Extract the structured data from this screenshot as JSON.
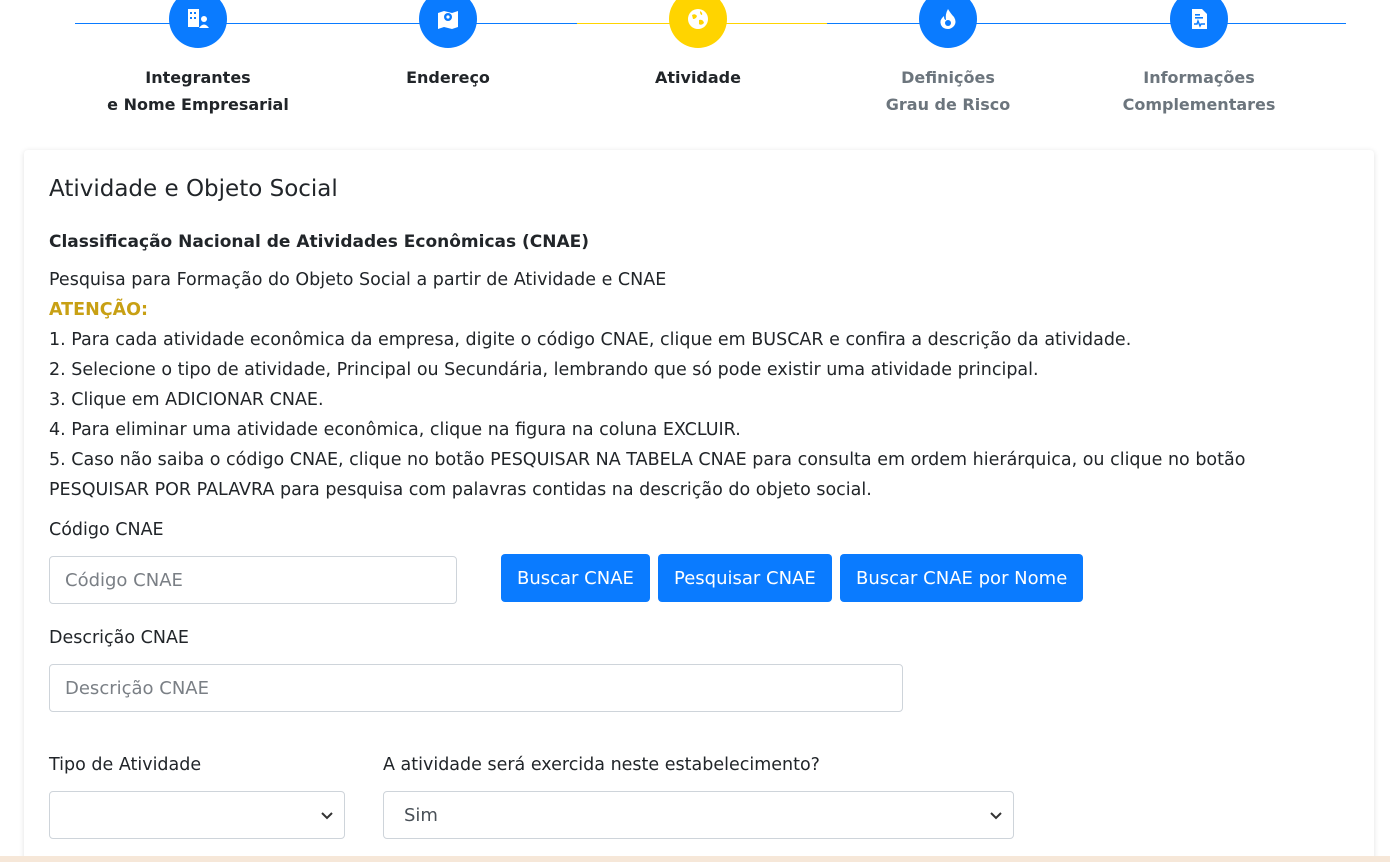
{
  "stepper": {
    "colors": {
      "active": "#0a7bff",
      "current": "#ffd400",
      "done_text": "#212529",
      "pending_text": "#6c757d"
    },
    "steps": [
      {
        "line1": "Integrantes",
        "line2": "e Nome Empresarial",
        "icon": "building-user-icon",
        "state": "done"
      },
      {
        "line1": "Endereço",
        "line2": "",
        "icon": "map-pin-icon",
        "state": "done"
      },
      {
        "line1": "Atividade",
        "line2": "",
        "icon": "globe-icon",
        "state": "current"
      },
      {
        "line1": "Definições",
        "line2": "Grau de Risco",
        "icon": "fire-icon",
        "state": "pending"
      },
      {
        "line1": "Informações",
        "line2": "Complementares",
        "icon": "document-icon",
        "state": "pending"
      }
    ]
  },
  "card": {
    "title": "Atividade e Objeto Social",
    "subtitle": "Classificação Nacional de Atividades Econômicas (CNAE)",
    "intro": "Pesquisa para Formação do Objeto Social a partir de Atividade e CNAE",
    "warning": "ATENÇÃO:",
    "steps": [
      "1. Para cada atividade econômica da empresa, digite o código CNAE, clique em BUSCAR e confira a descrição da atividade.",
      "2. Selecione o tipo de atividade, Principal ou Secundária, lembrando que só pode existir uma atividade principal.",
      "3. Clique em ADICIONAR CNAE.",
      "4. Para eliminar uma atividade econômica, clique na figura na coluna EXCLUIR.",
      "5. Caso não saiba o código CNAE, clique no botão PESQUISAR NA TABELA CNAE para consulta em ordem hierárquica, ou clique no botão PESQUISAR POR PALAVRA para pesquisa com palavras contidas na descrição do objeto social."
    ]
  },
  "form": {
    "codigo_label": "Código CNAE",
    "codigo_placeholder": "Código CNAE",
    "codigo_value": "",
    "buscar_btn": "Buscar CNAE",
    "pesquisar_btn": "Pesquisar CNAE",
    "buscar_nome_btn": "Buscar CNAE por Nome",
    "descricao_label": "Descrição CNAE",
    "descricao_placeholder": "Descrição CNAE",
    "descricao_value": "",
    "tipo_label": "Tipo de Atividade",
    "tipo_value": "",
    "exercida_label": "A atividade será exercida neste estabelecimento?",
    "exercida_value": "Sim"
  }
}
